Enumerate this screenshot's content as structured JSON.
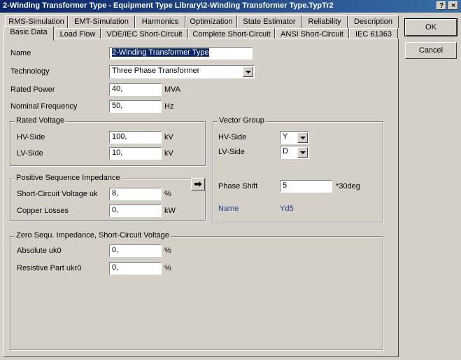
{
  "window": {
    "title": "2-Winding Transformer Type - Equipment Type Library\\2-Winding Transformer Type.TypTr2",
    "help_label": "?",
    "close_label": "×"
  },
  "tabs_row1": [
    {
      "label": "RMS-Simulation"
    },
    {
      "label": "EMT-Simulation"
    },
    {
      "label": "Harmonics"
    },
    {
      "label": "Optimization"
    },
    {
      "label": "State Estimator"
    },
    {
      "label": "Reliability"
    },
    {
      "label": "Description"
    }
  ],
  "tabs_row2": [
    {
      "label": "Basic Data"
    },
    {
      "label": "Load Flow"
    },
    {
      "label": "VDE/IEC Short-Circuit"
    },
    {
      "label": "Complete Short-Circuit"
    },
    {
      "label": "ANSI Short-Circuit"
    },
    {
      "label": "IEC 61363"
    }
  ],
  "buttons": {
    "ok": "OK",
    "cancel": "Cancel",
    "arrow": "➡"
  },
  "form": {
    "name_label": "Name",
    "name_value": "2-Winding Transformer Type",
    "technology_label": "Technology",
    "technology_value": "Three Phase Transformer",
    "rated_power_label": "Rated Power",
    "rated_power_value": "40,",
    "rated_power_unit": "MVA",
    "nominal_freq_label": "Nominal Frequency",
    "nominal_freq_value": "50,",
    "nominal_freq_unit": "Hz"
  },
  "rated_voltage": {
    "title": "Rated Voltage",
    "hv_label": "HV-Side",
    "hv_value": "100,",
    "hv_unit": "kV",
    "lv_label": "LV-Side",
    "lv_value": "10,",
    "lv_unit": "kV"
  },
  "vector_group": {
    "title": "Vector Group",
    "hv_label": "HV-Side",
    "hv_value": "Y",
    "lv_label": "LV-Side",
    "lv_value": "D",
    "phase_shift_label": "Phase Shift",
    "phase_shift_value": "5",
    "phase_shift_unit": "*30deg",
    "name_label": "Name",
    "name_value": "Yd5"
  },
  "pos_seq": {
    "title": "Positive Sequence Impedance",
    "uk_label": "Short-Circuit Voltage uk",
    "uk_value": "8,",
    "uk_unit": "%",
    "cu_label": "Copper Losses",
    "cu_value": "0,",
    "cu_unit": "kW"
  },
  "zero_seq": {
    "title": "Zero Sequ. Impedance, Short-Circuit Voltage",
    "uk0_label": "Absolute uk0",
    "uk0_value": "0,",
    "uk0_unit": "%",
    "ukr0_label": "Resistive Part ukr0",
    "ukr0_value": "0,",
    "ukr0_unit": "%"
  }
}
